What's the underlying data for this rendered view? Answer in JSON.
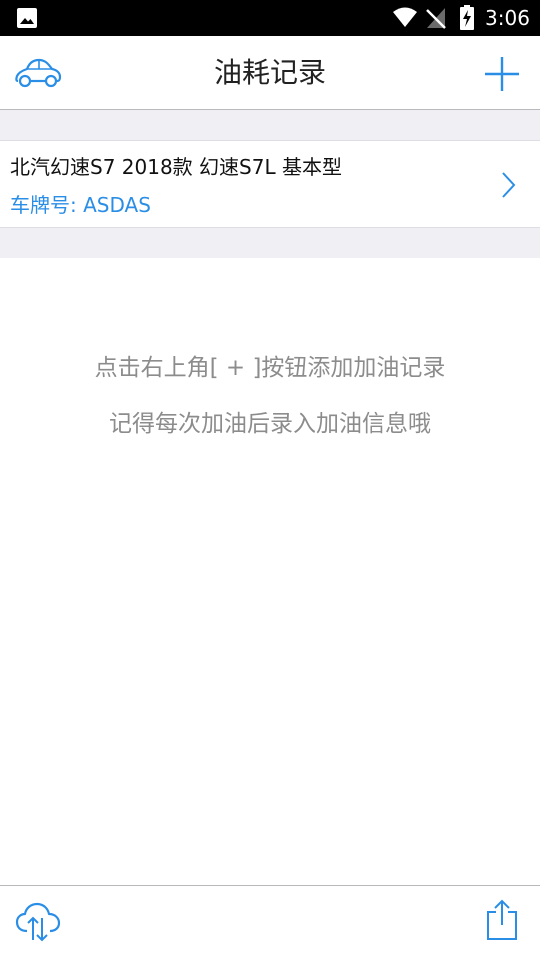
{
  "status_bar": {
    "time": "3:06",
    "icons": [
      "image-icon",
      "wifi-icon",
      "signal-off-icon",
      "battery-charging-icon"
    ]
  },
  "header": {
    "title": "油耗记录",
    "left_icon": "car-icon",
    "right_icon": "plus-icon"
  },
  "vehicle": {
    "model": "北汽幻速S7 2018款 幻速S7L 基本型",
    "plate_label": "车牌号: ",
    "plate_value": "ASDAS",
    "chevron_icon": "chevron-right-icon"
  },
  "empty_state": {
    "line1": "点击右上角[ + ]按钮添加加油记录",
    "line2": "记得每次加油后录入加油信息哦"
  },
  "bottom_bar": {
    "left_icon": "cloud-sync-icon",
    "right_icon": "share-icon"
  },
  "colors": {
    "accent": "#2a8ee6",
    "hint_text": "#8c8c8c",
    "separator_bg": "#efeff4"
  }
}
